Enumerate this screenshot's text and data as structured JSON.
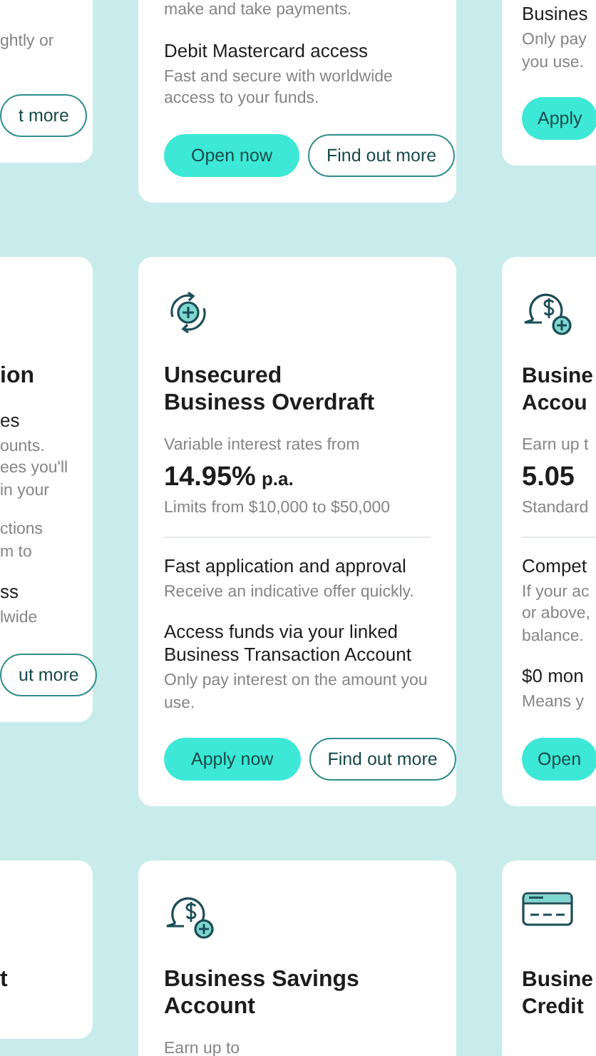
{
  "rows": [
    {
      "cards": [
        {
          "features": [
            {
              "text": "ghtly or"
            }
          ],
          "buttons": [
            {
              "label": "t more",
              "kind": "secondary"
            }
          ]
        },
        {
          "features": [
            {
              "text": "make and take payments."
            },
            {
              "heading": "Debit Mastercard access",
              "text": "Fast and secure with worldwide access to your funds."
            }
          ],
          "buttons": [
            {
              "label": "Open now",
              "kind": "primary"
            },
            {
              "label": "Find out more",
              "kind": "secondary"
            }
          ]
        },
        {
          "features": [
            {
              "heading": "Busines",
              "text": "Only pay\nyou use."
            }
          ],
          "buttons": [
            {
              "label": "Apply",
              "kind": "primary"
            }
          ]
        }
      ]
    },
    {
      "cards": [
        {
          "title": "ion",
          "features": [
            {
              "heading": "es",
              "text": "ounts.\nees you'll\nin your"
            },
            {
              "text": "ctions\nm to"
            },
            {
              "heading": "ss",
              "text": "lwide"
            }
          ],
          "buttons": [
            {
              "label": "ut more",
              "kind": "secondary"
            }
          ]
        },
        {
          "title": "Unsecured\nBusiness Overdraft",
          "rate_intro": "Variable interest rates from",
          "rate": "14.95%",
          "rate_suffix": "p.a.",
          "rate_note": "Limits from $10,000 to $50,000",
          "features": [
            {
              "heading": "Fast application and approval",
              "text": "Receive an indicative offer quickly."
            },
            {
              "heading": "Access funds via your linked Business Transaction Account",
              "text": "Only pay interest on the amount you use."
            }
          ],
          "buttons": [
            {
              "label": "Apply now",
              "kind": "primary"
            },
            {
              "label": "Find out more",
              "kind": "secondary"
            }
          ]
        },
        {
          "title": "Busine\nAccou",
          "rate_intro": "Earn up t",
          "rate": "5.05",
          "rate_note": "Standard",
          "features": [
            {
              "heading": "Compet",
              "text": "If your ac\nor above,\nbalance."
            },
            {
              "heading": "$0 mon",
              "text": "Means y"
            }
          ],
          "buttons": [
            {
              "label": "Open",
              "kind": "primary"
            }
          ]
        }
      ]
    },
    {
      "cards": [
        {
          "title": "t"
        },
        {
          "title": "Business Savings\nAccount",
          "rate_intro": "Earn up to"
        },
        {
          "title": "Busine\nCredit"
        }
      ]
    }
  ]
}
